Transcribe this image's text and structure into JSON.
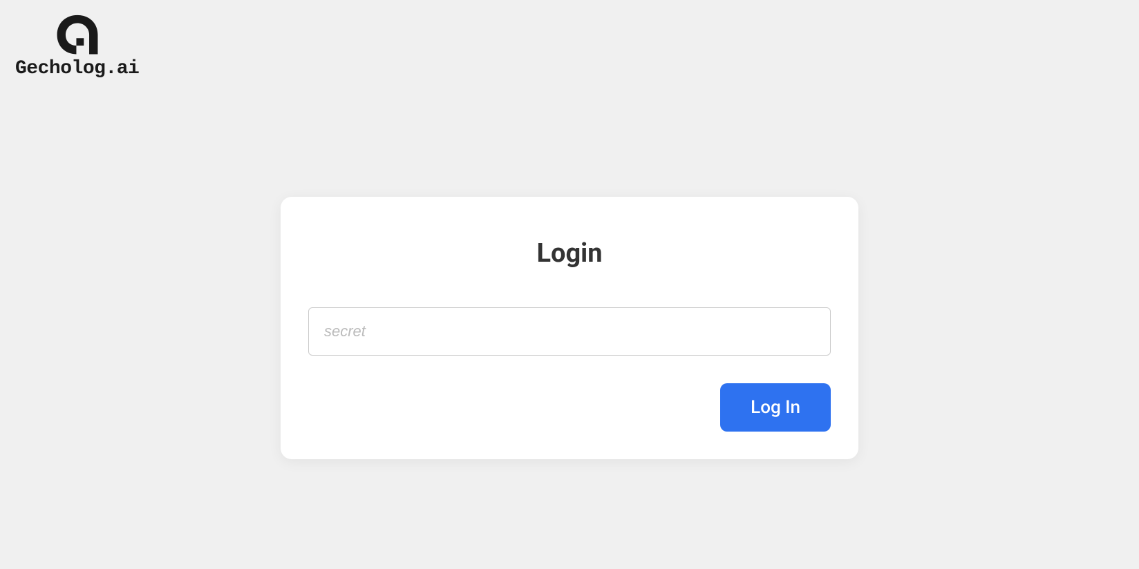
{
  "brand": {
    "name": "Gecholog.ai"
  },
  "login": {
    "title": "Login",
    "secret_placeholder": "secret",
    "secret_value": "",
    "button_label": "Log In"
  }
}
